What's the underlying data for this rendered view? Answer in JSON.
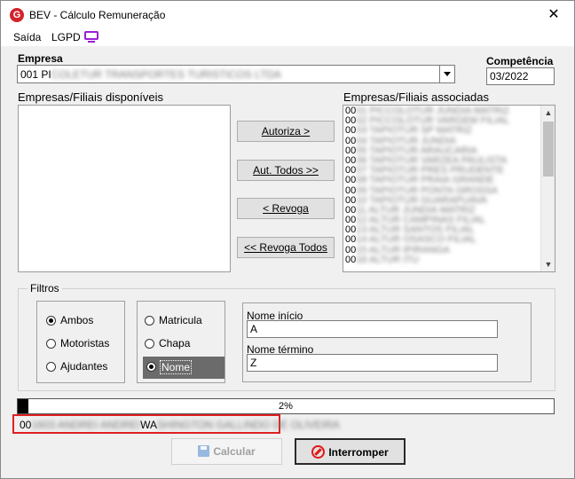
{
  "window": {
    "title": "BEV - Cálculo Remuneração",
    "close_glyph": "✕",
    "logo_letter": "G"
  },
  "menu": {
    "items": [
      "Saída",
      "LGPD"
    ],
    "icon": "monitor-icon",
    "icon_color": "#9b1fd4"
  },
  "empresa": {
    "label": "Empresa",
    "value_prefix": "001 PI",
    "value_rest": "COLETUR TRANSPORTES TURISTICOS LTDA"
  },
  "competencia": {
    "label": "Competência",
    "value": "03/2022"
  },
  "disponiveis": {
    "label": "Empresas/Filiais disponíveis",
    "items": []
  },
  "associadas": {
    "label": "Empresas/Filiais associadas",
    "items": [
      {
        "prefix": "00",
        "rest": "01 PICCOLOTUR JUNDIA MATRIZ"
      },
      {
        "prefix": "00",
        "rest": "02 PICCOLOTUR VARGEM FILIAL"
      },
      {
        "prefix": "00",
        "rest": "03 TAPIOTUR SP MATRIZ"
      },
      {
        "prefix": "00",
        "rest": "04 TAPIOTUR JUNDIA"
      },
      {
        "prefix": "00",
        "rest": "05 TAPIOTUR ARAUCARIA"
      },
      {
        "prefix": "00",
        "rest": "06 TAPIOTUR VARZEA PAULISTA"
      },
      {
        "prefix": "00",
        "rest": "07 TAPIOTUR PRES PRUDENTE"
      },
      {
        "prefix": "00",
        "rest": "08 TAPIOTUR PRAIA GRANDE"
      },
      {
        "prefix": "00",
        "rest": "09 TAPIOTUR PONTA GROSSA"
      },
      {
        "prefix": "00",
        "rest": "10 TAPIOTUR GUARAPUAVA"
      },
      {
        "prefix": "00",
        "rest": "11 ALTUR JUNDIA MATRIZ"
      },
      {
        "prefix": "00",
        "rest": "12 ALTUR CAMPINAS FILIAL"
      },
      {
        "prefix": "00",
        "rest": "13 ALTUR SANTOS FILIAL"
      },
      {
        "prefix": "00",
        "rest": "14 ALTUR OSASCO FILIAL"
      },
      {
        "prefix": "00",
        "rest": "15 ALTUR IPIRANGA"
      },
      {
        "prefix": "00",
        "rest": "16 ALTUR ITU"
      }
    ]
  },
  "buttons": {
    "autoriza": "Autoriza >",
    "aut_todos": "Aut. Todos >>",
    "revoga": "< Revoga",
    "revoga_todos": "<< Revoga Todos",
    "calcular": "Calcular",
    "interromper": "Interromper"
  },
  "filtros": {
    "title": "Filtros",
    "grupo1": {
      "options": [
        "Ambos",
        "Motoristas",
        "Ajudantes"
      ],
      "selected": "Ambos"
    },
    "grupo2": {
      "options": [
        "Matricula",
        "Chapa",
        "Nome"
      ],
      "selected": "Nome"
    },
    "nome_inicio": {
      "label": "Nome início",
      "value": "A"
    },
    "nome_termino": {
      "label": "Nome término",
      "value": "Z"
    }
  },
  "progress": {
    "percent_text": "2%",
    "fraction": 0.02
  },
  "status": {
    "prefix": "00",
    "middle_blur": "1603 ANDREI ANDREI",
    "visible": "WA",
    "suffix_blur": "SHINGTON GALLINDO DE OLIVEIRA"
  },
  "colors": {
    "highlight_box": "#e02020",
    "progress_fill": "#000000",
    "selected_radio_bg": "#6b6b6b"
  }
}
